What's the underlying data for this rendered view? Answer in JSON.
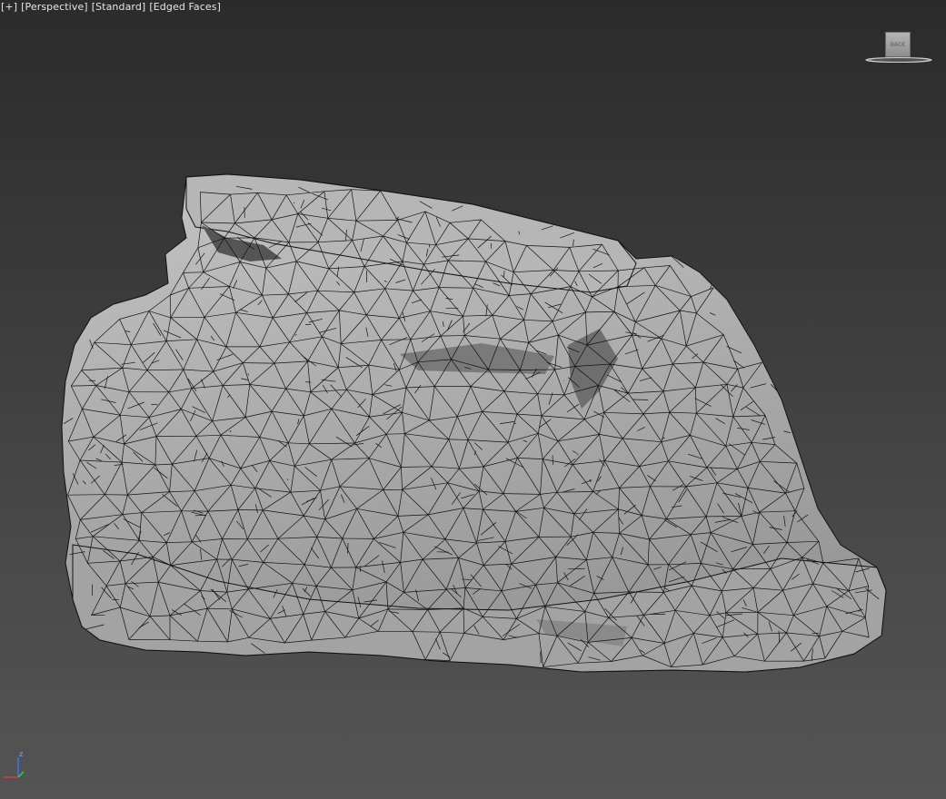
{
  "viewport": {
    "label_plus": "[+]",
    "label_view": "[Perspective]",
    "label_shading": "[Standard]",
    "label_display": "[Edged Faces]"
  },
  "viewcube": {
    "face_label": "BACK"
  },
  "axis": {
    "z_label": "z"
  },
  "colors": {
    "mesh_fill": "#a9a9a9",
    "mesh_edge": "#111111",
    "axis_x": "#d83a3a",
    "axis_y": "#3ad83a",
    "axis_z": "#3a78ff"
  }
}
